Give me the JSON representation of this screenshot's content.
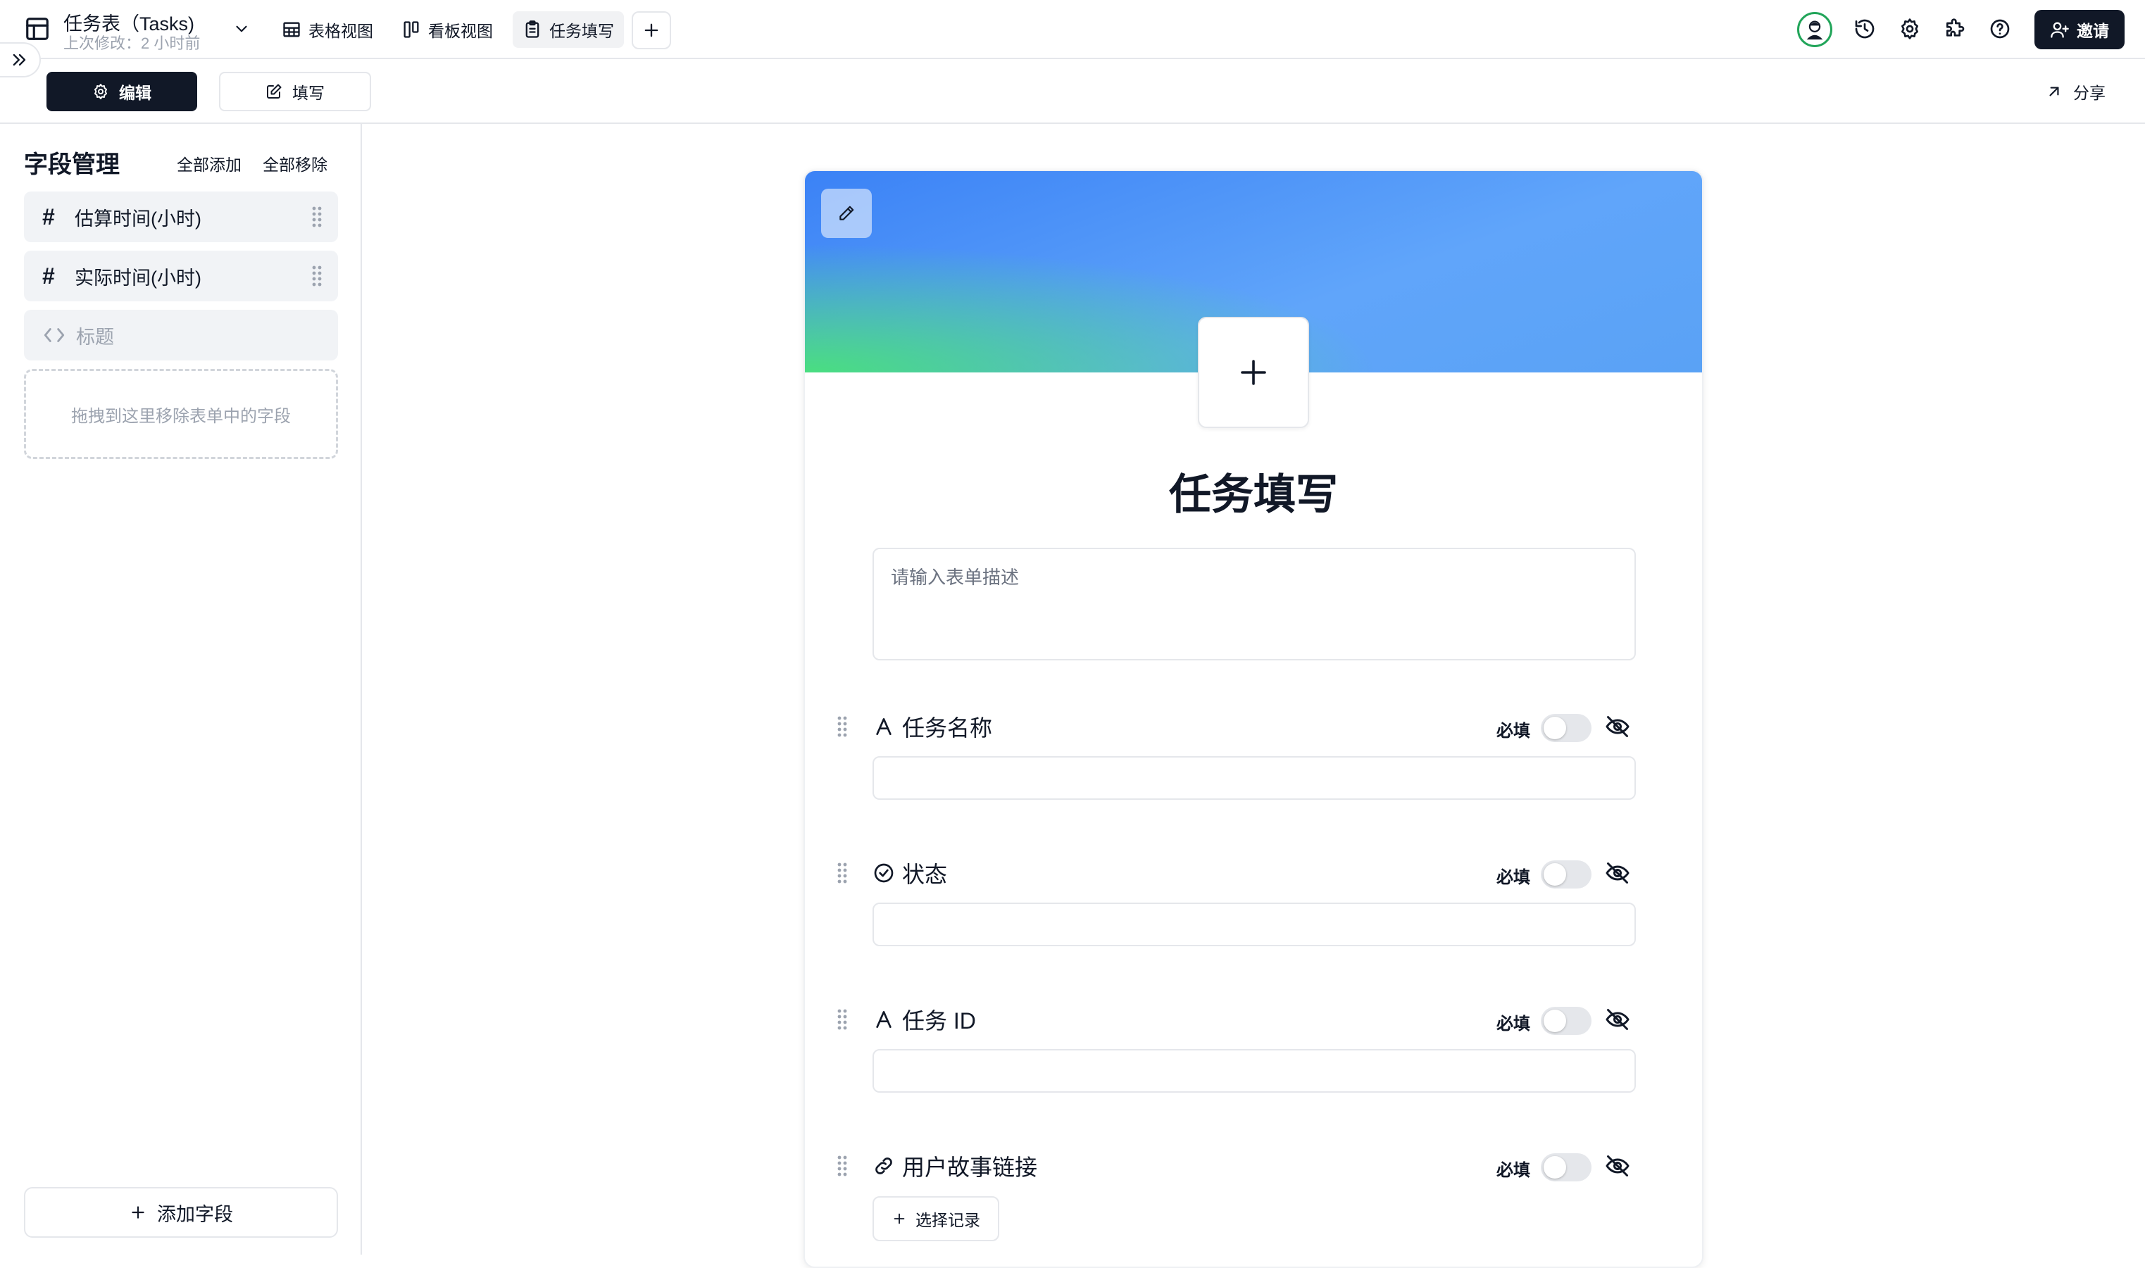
{
  "header": {
    "title": "任务表（Tasks)",
    "subtitle": "上次修改：2 小时前",
    "views": [
      {
        "label": "表格视图",
        "icon": "grid-table-icon"
      },
      {
        "label": "看板视图",
        "icon": "kanban-icon"
      },
      {
        "label": "任务填写",
        "icon": "clipboard-form-icon",
        "active": true
      }
    ],
    "right_icons": [
      "user-avatar",
      "history-icon",
      "settings-gear-icon",
      "puzzle-plugin-icon",
      "help-question-icon"
    ],
    "invite_label": "邀请"
  },
  "modebar": {
    "edit_label": "编辑",
    "fill_label": "填写",
    "share_label": "分享"
  },
  "field_panel": {
    "title": "字段管理",
    "add_all": "全部添加",
    "remove_all": "全部移除",
    "fields": [
      {
        "name": "估算时间(小时)",
        "type": "number"
      },
      {
        "name": "实际时间(小时)",
        "type": "number"
      },
      {
        "name": "标题",
        "type": "formula"
      }
    ],
    "drop_hint": "拖拽到这里移除表单中的字段",
    "add_field_label": "添加字段"
  },
  "form": {
    "title": "任务填写",
    "description_placeholder": "请输入表单描述",
    "required_label": "必填",
    "questions": [
      {
        "label": "任务名称",
        "type": "text",
        "icon": "text-a-icon",
        "required": false
      },
      {
        "label": "状态",
        "type": "select",
        "icon": "check-circle-icon",
        "required": false
      },
      {
        "label": "任务 ID",
        "type": "text",
        "icon": "text-a-icon",
        "required": false
      },
      {
        "label": "用户故事链接",
        "type": "link",
        "icon": "link-icon",
        "required": false
      }
    ],
    "select_record_label": "选择记录"
  },
  "colors": {
    "primary_dark": "#111827",
    "border": "#e5e7eb",
    "muted_text": "#9ca3af",
    "avatar_ring": "#22a55a",
    "banner_blue": "#3b82f6",
    "banner_green": "#4ade80"
  }
}
